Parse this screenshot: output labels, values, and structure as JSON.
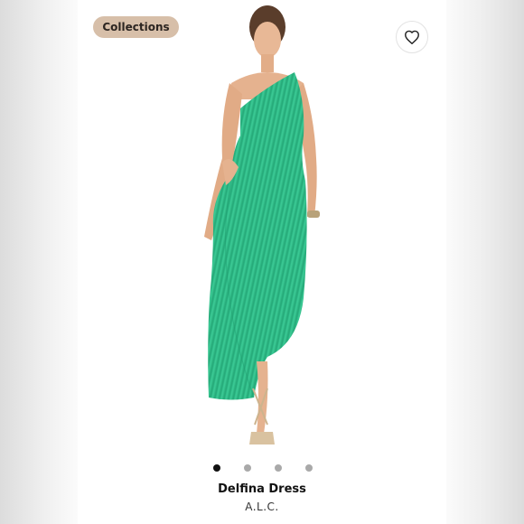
{
  "chip": {
    "label": "Collections"
  },
  "product": {
    "name": "Delfina Dress",
    "brand": "A.L.C."
  },
  "colors": {
    "dress": "#2fc08b",
    "dress_shadow": "#1f9e6f",
    "chip_bg": "#d7bfa9",
    "skin": "#e5b28f"
  },
  "icons": {
    "like": "heart-outline-icon"
  },
  "carousel": {
    "total": 4,
    "active_index": 0
  }
}
